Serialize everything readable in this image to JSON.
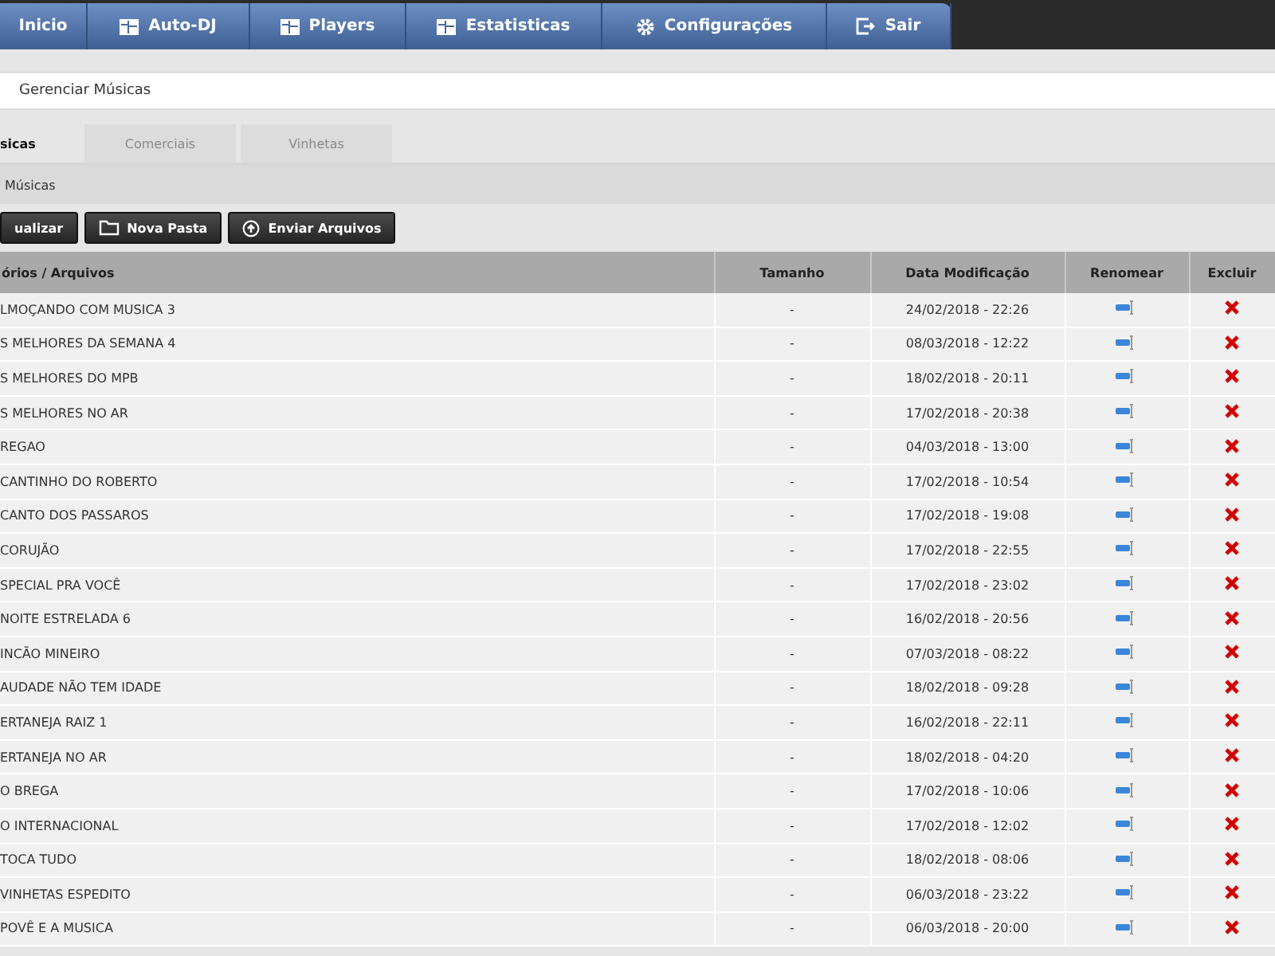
{
  "nav": [
    {
      "label": "Inicio",
      "kind": "plain"
    },
    {
      "label": "Auto-DJ",
      "kind": "grid"
    },
    {
      "label": "Players",
      "kind": "grid"
    },
    {
      "label": "Estatisticas",
      "kind": "grid"
    },
    {
      "label": "Configurações",
      "kind": "gear"
    },
    {
      "label": "Sair",
      "kind": "exit"
    }
  ],
  "page_title": "Gerenciar Músicas",
  "tabs": [
    {
      "label": "sicas",
      "selected": true
    },
    {
      "label": "Comerciais",
      "selected": false
    },
    {
      "label": "Vinhetas",
      "selected": false
    }
  ],
  "breadcrumb": "Músicas",
  "buttons": [
    {
      "label": "ualizar",
      "kind": "plain"
    },
    {
      "label": "Nova Pasta",
      "kind": "folder"
    },
    {
      "label": "Enviar Arquivos",
      "kind": "upload"
    }
  ],
  "table": {
    "columns": [
      "órios / Arquivos",
      "Tamanho",
      "Data Modificação",
      "Renomear",
      "Excluir"
    ],
    "rows": [
      {
        "name": "LMOÇANDO COM MUSICA 3",
        "size": "-",
        "date": "24/02/2018 - 22:26"
      },
      {
        "name": "S MELHORES DA SEMANA 4",
        "size": "-",
        "date": "08/03/2018 - 12:22"
      },
      {
        "name": "S MELHORES DO MPB",
        "size": "-",
        "date": "18/02/2018 - 20:11"
      },
      {
        "name": "S MELHORES NO AR",
        "size": "-",
        "date": "17/02/2018 - 20:38"
      },
      {
        "name": "REGAO",
        "size": "-",
        "date": "04/03/2018 - 13:00"
      },
      {
        "name": "CANTINHO DO ROBERTO",
        "size": "-",
        "date": "17/02/2018 - 10:54"
      },
      {
        "name": "CANTO DOS PASSAROS",
        "size": "-",
        "date": "17/02/2018 - 19:08"
      },
      {
        "name": "CORUJÃO",
        "size": "-",
        "date": "17/02/2018 - 22:55"
      },
      {
        "name": "SPECIAL PRA VOCÊ",
        "size": "-",
        "date": "17/02/2018 - 23:02"
      },
      {
        "name": "NOITE ESTRELADA 6",
        "size": "-",
        "date": "16/02/2018 - 20:56"
      },
      {
        "name": "INCÃO MINEIRO",
        "size": "-",
        "date": "07/03/2018 - 08:22"
      },
      {
        "name": "AUDADE NÃO TEM IDADE",
        "size": "-",
        "date": "18/02/2018 - 09:28"
      },
      {
        "name": "ERTANEJA RAIZ 1",
        "size": "-",
        "date": "16/02/2018 - 22:11"
      },
      {
        "name": "ERTANEJA NO AR",
        "size": "-",
        "date": "18/02/2018 - 04:20"
      },
      {
        "name": "O BREGA",
        "size": "-",
        "date": "17/02/2018 - 10:06"
      },
      {
        "name": "O INTERNACIONAL",
        "size": "-",
        "date": "17/02/2018 - 12:02"
      },
      {
        "name": "TOCA TUDO",
        "size": "-",
        "date": "18/02/2018 - 08:06"
      },
      {
        "name": "VINHETAS ESPEDITO",
        "size": "-",
        "date": "06/03/2018 - 23:22"
      },
      {
        "name": "POVÊ E A MUSICA",
        "size": "-",
        "date": "06/03/2018 - 20:00"
      }
    ]
  }
}
